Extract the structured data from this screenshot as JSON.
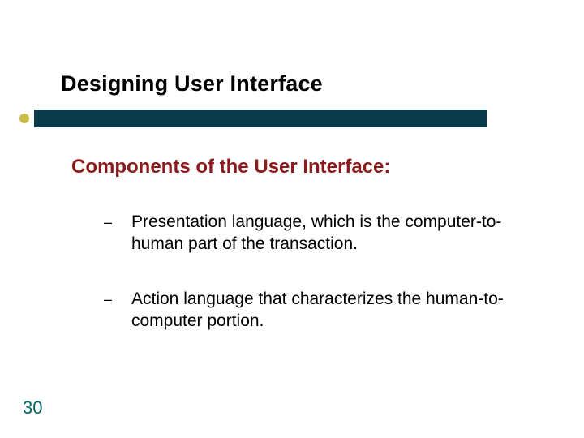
{
  "title": "Designing User Interface",
  "subtitle": "Components of the User Interface:",
  "bullets": [
    {
      "text": "Presentation language, which is the computer-to-human part of the transaction."
    },
    {
      "text": "Action language that characterizes the human-to-computer portion."
    }
  ],
  "page_number": "30",
  "colors": {
    "accent_bar": "#0a3a4a",
    "accent_dot": "#ccbb44",
    "subtitle": "#8b1a1a",
    "pagenum": "#006666"
  }
}
